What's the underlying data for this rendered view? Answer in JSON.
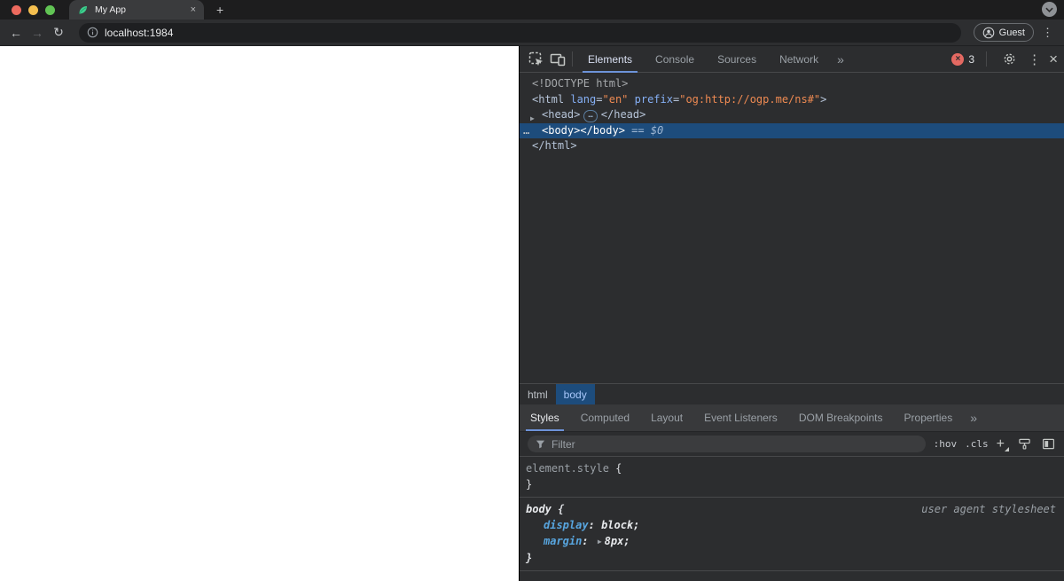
{
  "browser": {
    "tab_title": "My App",
    "tab_close": "×",
    "new_tab": "+",
    "back": "←",
    "forward": "→",
    "reload": "↻",
    "url": "localhost:1984",
    "guest_label": "Guest",
    "menu": "⋮",
    "traffic_colors": {
      "close": "#ed6a5e",
      "minimize": "#f5bf4f",
      "zoom": "#61c454"
    }
  },
  "devtools": {
    "toolbar": {
      "tabs": [
        "Elements",
        "Console",
        "Sources",
        "Network"
      ],
      "active_tab": "Elements",
      "more": "»",
      "error_x": "×",
      "error_count": "3",
      "menu": "⋮",
      "close": "×"
    },
    "dom": {
      "doctype": "<!DOCTYPE html>",
      "html_open": "<html ",
      "attr1_name": "lang",
      "attr1_eq": "=",
      "attr1_value": "\"en\" ",
      "attr2_name": "prefix",
      "attr2_eq": "=",
      "attr2_value": "\"og:http://ogp.me/ns#\"",
      "html_open_end": ">",
      "head_expander": "▶",
      "head_open": "<head>",
      "head_ellipsis": "…",
      "head_close": "</head>",
      "body_gutter": "…",
      "body_text": "<body></body>",
      "body_eq": " == ",
      "body_dollar": "$0",
      "html_close": "</html>"
    },
    "crumbs": [
      "html",
      "body"
    ],
    "sidebar_tabs": [
      "Styles",
      "Computed",
      "Layout",
      "Event Listeners",
      "DOM Breakpoints",
      "Properties"
    ],
    "sidebar_more": "»",
    "filter_placeholder": "Filter",
    "hov": ":hov",
    "cls": ".cls",
    "plus": "+",
    "styles": {
      "rule1_selector": "element.style",
      "space_brace": " {",
      "brace_close": "}",
      "rule2_selector": "body",
      "rule2_origin": "user agent stylesheet",
      "prop1_name": "display",
      "prop1_sep": ": ",
      "prop1_value": "block;",
      "prop2_name": "margin",
      "prop2_sep": ": ",
      "prop2_expander": "▶",
      "prop2_value": "8px;"
    },
    "accent_colors": {
      "selection": "#1d4c7c",
      "error": "#e46962",
      "tab_underline": "#6d93d9"
    }
  }
}
